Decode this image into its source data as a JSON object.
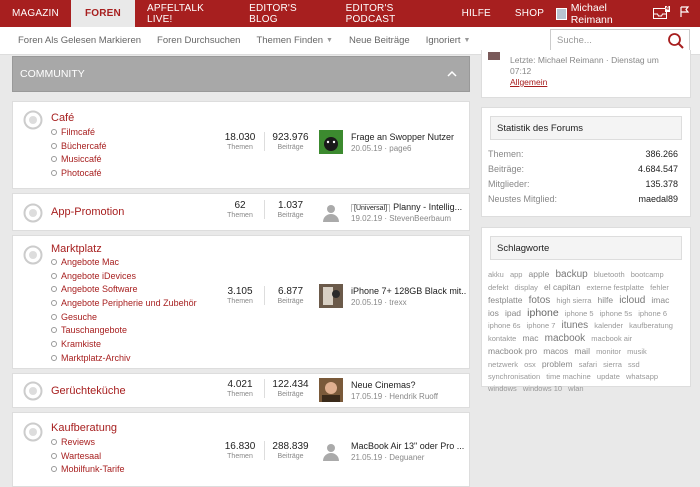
{
  "nav": {
    "tabs": [
      "Magazin",
      "Foren",
      "Apfeltalk Live!",
      "Editor's Blog",
      "Editor's Podcast",
      "Hilfe",
      "Shop"
    ],
    "active": "Foren",
    "user_name": "Michael Reimann",
    "alerts_count": "4"
  },
  "subnav": {
    "links": [
      "Foren Als Gelesen Markieren",
      "Foren Durchsuchen",
      "Themen Finden",
      "Neue Beiträge",
      "Ignoriert"
    ],
    "search_placeholder": "Suche..."
  },
  "community": {
    "title": "Community",
    "nodes": [
      {
        "title": "Café",
        "subs": [
          "Filmcafé",
          "Büchercafé",
          "Musiccafé",
          "Photocafé"
        ],
        "themen": "18.030",
        "beitraege": "923.976",
        "last_title": "Frage an Swopper Nutzer",
        "last_prefix": "",
        "last_meta": "20.05.19 · page6",
        "thumb": "dog"
      },
      {
        "title": "App-Promotion",
        "subs": [],
        "themen": "62",
        "beitraege": "1.037",
        "last_title": "Planny - Intellig...",
        "last_prefix": "[Universal]",
        "last_meta": "19.02.19 · StevenBeerbaum",
        "thumb": "default"
      },
      {
        "title": "Marktplatz",
        "subs": [
          "Angebote Mac",
          "Angebote iDevices",
          "Angebote Software",
          "Angebote Peripherie und Zubehör",
          "Gesuche",
          "Tauschangebote",
          "Kramkiste",
          "Marktplatz-Archiv"
        ],
        "themen": "3.105",
        "beitraege": "6.877",
        "last_title": "iPhone 7+ 128GB Black mit...",
        "last_prefix": "",
        "last_meta": "20.05.19 · trexx",
        "thumb": "photo"
      },
      {
        "title": "Gerüchteküche",
        "subs": [],
        "themen": "4.021",
        "beitraege": "122.434",
        "last_title": "Neue Cinemas?",
        "last_prefix": "",
        "last_meta": "17.05.19 · Hendrik Ruoff",
        "thumb": "photo2"
      },
      {
        "title": "Kaufberatung",
        "subs": [
          "Reviews",
          "Wartesaal",
          "Mobilfunk-Tarife"
        ],
        "themen": "16.830",
        "beitraege": "288.839",
        "last_title": "MacBook Air 13\" oder Pro ...",
        "last_prefix": "",
        "last_meta": "21.05.19 · Deguaner",
        "thumb": "default"
      }
    ],
    "themen_label": "Themen",
    "beitraege_label": "Beiträge"
  },
  "sidebar": {
    "latest_line": "Letzte: Michael Reimann · Dienstag um",
    "latest_time": "07:12",
    "latest_node": "Allgemein",
    "stats_title": "Statistik des Forums",
    "stats": [
      {
        "k": "Themen:",
        "v": "386.266"
      },
      {
        "k": "Beiträge:",
        "v": "4.684.547"
      },
      {
        "k": "Mitglieder:",
        "v": "135.378"
      },
      {
        "k": "Neustes Mitglied:",
        "v": "maedal89"
      }
    ],
    "tags_title": "Schlagworte",
    "tags": [
      {
        "t": "akku",
        "s": "sm"
      },
      {
        "t": "app",
        "s": "sm"
      },
      {
        "t": "apple",
        "s": "md"
      },
      {
        "t": "backup",
        "s": "lg"
      },
      {
        "t": "bluetooth",
        "s": "sm"
      },
      {
        "t": "bootcamp",
        "s": "sm"
      },
      {
        "t": "defekt",
        "s": "sm"
      },
      {
        "t": "display",
        "s": "sm"
      },
      {
        "t": "el capitan",
        "s": "md"
      },
      {
        "t": "externe festplatte",
        "s": "sm"
      },
      {
        "t": "fehler",
        "s": "sm"
      },
      {
        "t": "festplatte",
        "s": "md"
      },
      {
        "t": "fotos",
        "s": "lg"
      },
      {
        "t": "high sierra",
        "s": "sm"
      },
      {
        "t": "hilfe",
        "s": "md"
      },
      {
        "t": "icloud",
        "s": "lg"
      },
      {
        "t": "imac",
        "s": "md"
      },
      {
        "t": "ios",
        "s": "md"
      },
      {
        "t": "ipad",
        "s": "md"
      },
      {
        "t": "iphone",
        "s": "xl"
      },
      {
        "t": "iphone 5",
        "s": "sm"
      },
      {
        "t": "iphone 5s",
        "s": "sm"
      },
      {
        "t": "iphone 6",
        "s": "sm"
      },
      {
        "t": "iphone 6s",
        "s": "sm"
      },
      {
        "t": "iphone 7",
        "s": "sm"
      },
      {
        "t": "itunes",
        "s": "lg"
      },
      {
        "t": "kalender",
        "s": "sm"
      },
      {
        "t": "kaufberatung",
        "s": "sm"
      },
      {
        "t": "kontakte",
        "s": "sm"
      },
      {
        "t": "mac",
        "s": "md"
      },
      {
        "t": "macbook",
        "s": "lg"
      },
      {
        "t": "macbook air",
        "s": "sm"
      },
      {
        "t": "macbook pro",
        "s": "md"
      },
      {
        "t": "macos",
        "s": "md"
      },
      {
        "t": "mail",
        "s": "md"
      },
      {
        "t": "monitor",
        "s": "sm"
      },
      {
        "t": "musik",
        "s": "sm"
      },
      {
        "t": "netzwerk",
        "s": "sm"
      },
      {
        "t": "osx",
        "s": "sm"
      },
      {
        "t": "problem",
        "s": "md"
      },
      {
        "t": "safari",
        "s": "sm"
      },
      {
        "t": "sierra",
        "s": "sm"
      },
      {
        "t": "ssd",
        "s": "sm"
      },
      {
        "t": "synchronisation",
        "s": "sm"
      },
      {
        "t": "time machine",
        "s": "sm"
      },
      {
        "t": "update",
        "s": "sm"
      },
      {
        "t": "whatsapp",
        "s": "sm"
      },
      {
        "t": "windows",
        "s": "sm"
      },
      {
        "t": "windows 10",
        "s": "sm"
      },
      {
        "t": "wlan",
        "s": "sm"
      }
    ]
  },
  "colors": {
    "accent": "#a71f1f",
    "header_gray": "#a8a8a8"
  }
}
